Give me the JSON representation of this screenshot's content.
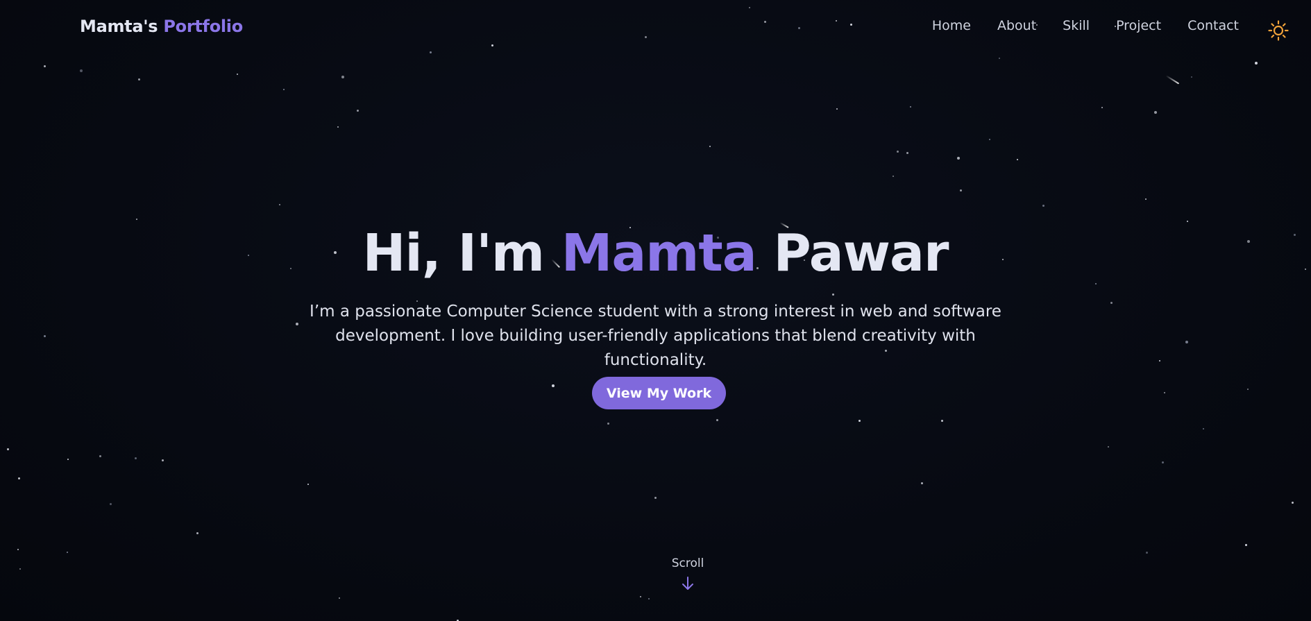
{
  "brand": {
    "name": "Mamta's",
    "accent": "Portfolio"
  },
  "nav": {
    "items": [
      {
        "label": "Home"
      },
      {
        "label": "About"
      },
      {
        "label": "Skill"
      },
      {
        "label": "Project"
      },
      {
        "label": "Contact"
      }
    ],
    "theme_toggle_icon": "sun-icon"
  },
  "hero": {
    "greeting": "Hi, I'm",
    "first_name": "Mamta",
    "last_name": "Pawar",
    "subtitle_line1": "I’m a passionate Computer Science student with a strong interest in web and software",
    "subtitle_line2": "development. I love building user-friendly applications that blend creativity with functionality.",
    "cta_label": "View My Work"
  },
  "scroll": {
    "label": "Scroll",
    "icon": "arrow-down-icon"
  },
  "colors": {
    "background": "#070a12",
    "accent": "#8b76e8",
    "button": "#8069dc",
    "text": "#e4e7f3",
    "sun": "#f0a23a"
  }
}
